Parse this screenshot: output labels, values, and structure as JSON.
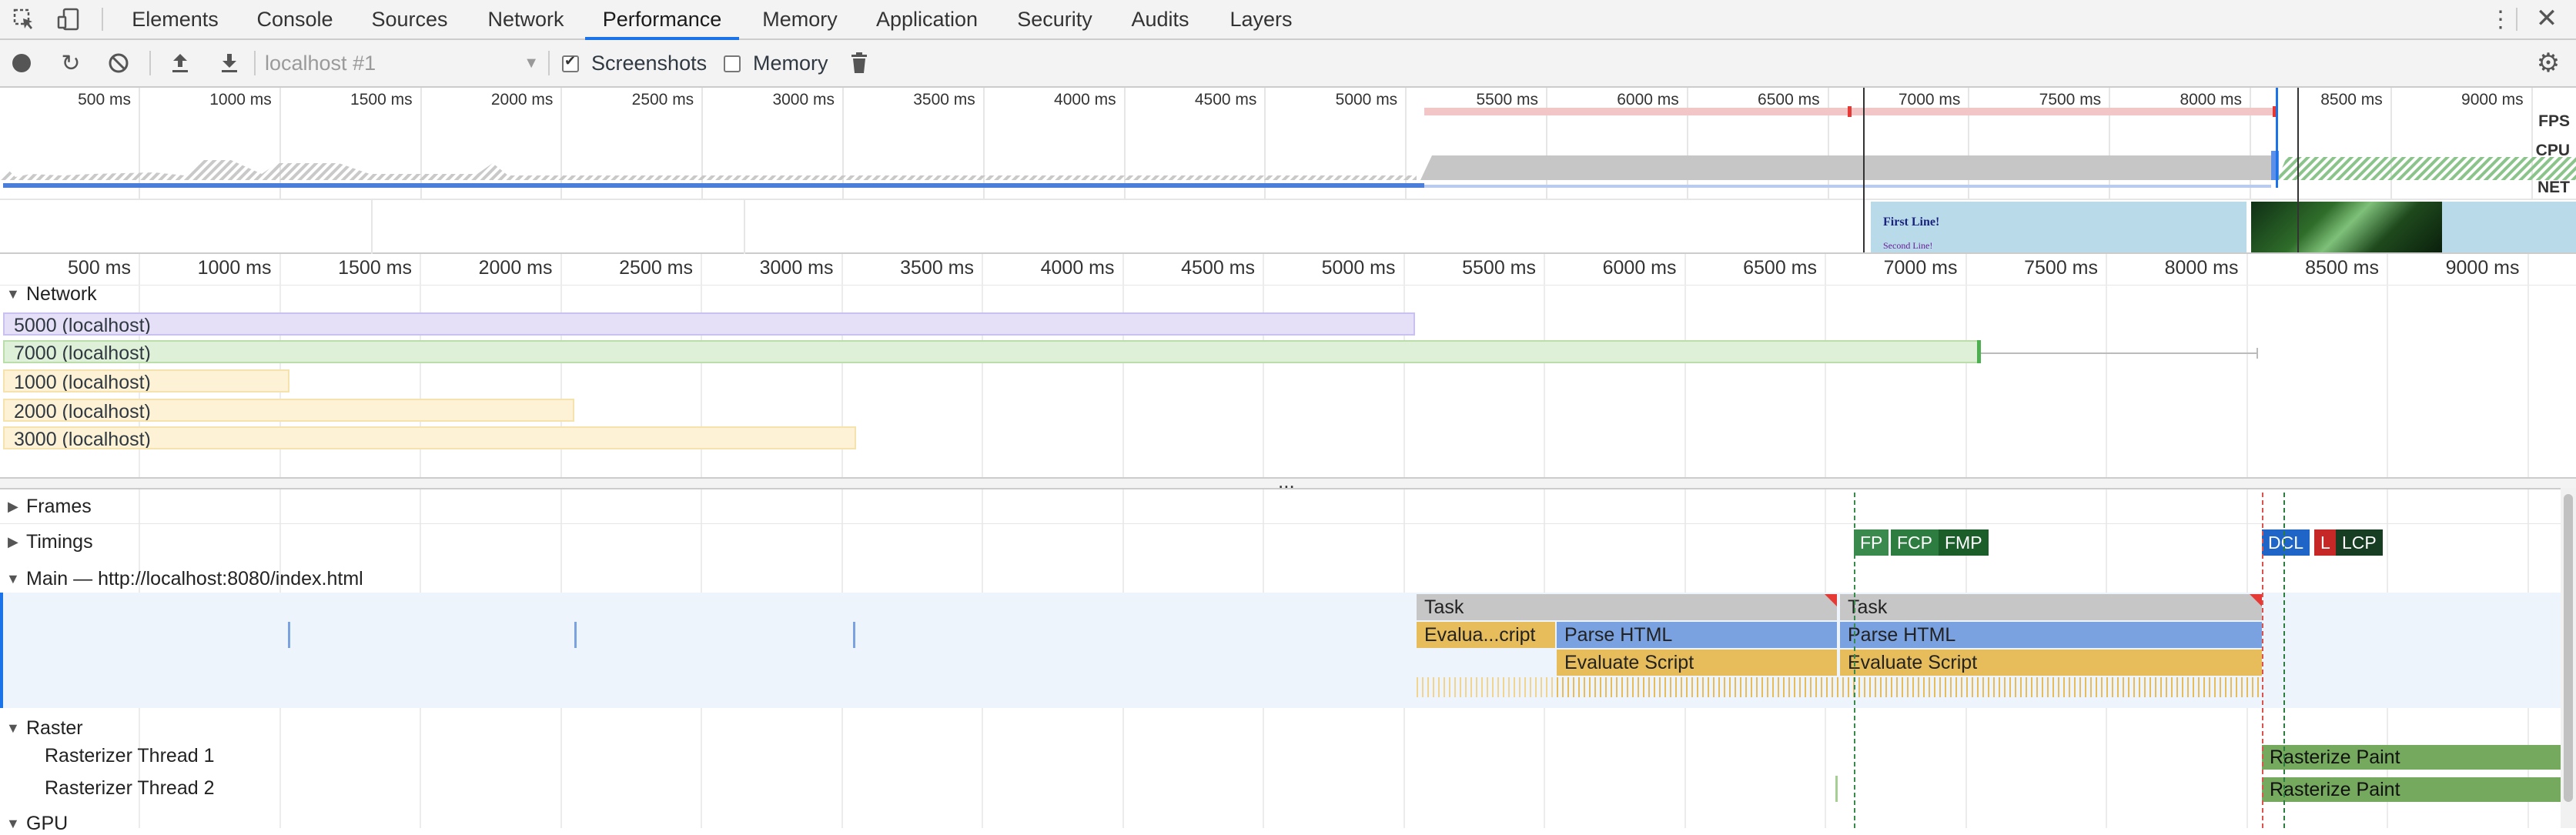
{
  "tabs": [
    {
      "label": "Elements",
      "active": false
    },
    {
      "label": "Console",
      "active": false
    },
    {
      "label": "Sources",
      "active": false
    },
    {
      "label": "Network",
      "active": false
    },
    {
      "label": "Performance",
      "active": true
    },
    {
      "label": "Memory",
      "active": false
    },
    {
      "label": "Application",
      "active": false
    },
    {
      "label": "Security",
      "active": false
    },
    {
      "label": "Audits",
      "active": false
    },
    {
      "label": "Layers",
      "active": false
    }
  ],
  "toolbar": {
    "profile_select": "localhost #1",
    "screenshots_label": "Screenshots",
    "screenshots_checked": true,
    "memory_label": "Memory",
    "memory_checked": false
  },
  "overview": {
    "ticks": [
      "500 ms",
      "1000 ms",
      "1500 ms",
      "2000 ms",
      "2500 ms",
      "3000 ms",
      "3500 ms",
      "4000 ms",
      "4500 ms",
      "5000 ms",
      "5500 ms",
      "6000 ms",
      "6500 ms",
      "7000 ms",
      "7500 ms",
      "8000 ms",
      "8500 ms",
      "9000 ms"
    ],
    "lanes": {
      "fps": "FPS",
      "cpu": "CPU",
      "net": "NET"
    },
    "screenshot_text": {
      "line1": "First Line!",
      "line2": "Second Line!"
    }
  },
  "timeline_ticks": [
    "500 ms",
    "1000 ms",
    "1500 ms",
    "2000 ms",
    "2500 ms",
    "3000 ms",
    "3500 ms",
    "4000 ms",
    "4500 ms",
    "5000 ms",
    "5500 ms",
    "6000 ms",
    "6500 ms",
    "7000 ms",
    "7500 ms",
    "8000 ms",
    "8500 ms",
    "9000 ms"
  ],
  "network": {
    "title": "Network",
    "requests": [
      {
        "label": "5000 (localhost)"
      },
      {
        "label": "7000 (localhost)"
      },
      {
        "label": "1000 (localhost)"
      },
      {
        "label": "2000 (localhost)"
      },
      {
        "label": "3000 (localhost)"
      }
    ]
  },
  "resizer": "...",
  "sections": {
    "frames": "Frames",
    "timings": "Timings",
    "main": "Main — http://localhost:8080/index.html",
    "raster": "Raster",
    "raster_thread_1": "Rasterizer Thread 1",
    "raster_thread_2": "Rasterizer Thread 2",
    "gpu": "GPU"
  },
  "timings_markers": [
    {
      "label": "FP",
      "color": "#3a8a4e"
    },
    {
      "label": "FCP",
      "color": "#2e7d40"
    },
    {
      "label": "FMP",
      "color": "#1b5e2a"
    },
    {
      "label": "DCL",
      "color": "#1f64c7"
    },
    {
      "label": "L",
      "color": "#c62828"
    },
    {
      "label": "LCP",
      "color": "#173d22"
    }
  ],
  "main_flame": {
    "task1": "Task",
    "task2": "Task",
    "evaluate_short": "Evalua...cript",
    "parse1": "Parse HTML",
    "parse2": "Parse HTML",
    "eval1": "Evaluate Script",
    "eval2": "Evaluate Script"
  },
  "raster": {
    "paint1": "Rasterize Paint",
    "paint2": "Rasterize Paint"
  },
  "colors": {
    "accent": "#1a73e8",
    "task": "#c6c6c6",
    "parse": "#7aa2e0",
    "script": "#e7bd5c",
    "paint": "#75a95e"
  }
}
